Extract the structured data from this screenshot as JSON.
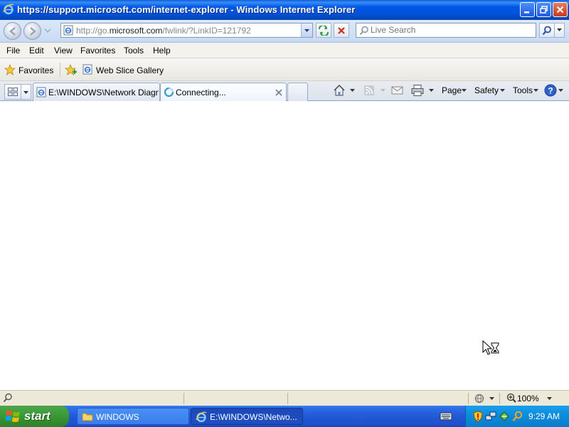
{
  "window": {
    "title": "https://support.microsoft.com/internet-explorer - Windows Internet Explorer"
  },
  "address": {
    "url_prefix": "http://go.",
    "url_domain": "microsoft.com",
    "url_suffix": "/fwlink/?LinkID=121792"
  },
  "search": {
    "placeholder": "Live Search"
  },
  "menu": {
    "items": [
      "File",
      "Edit",
      "View",
      "Favorites",
      "Tools",
      "Help"
    ]
  },
  "favorites_bar": {
    "favorites_label": "Favorites",
    "web_slice_label": "Web Slice Gallery"
  },
  "tabs": [
    {
      "label": "E:\\WINDOWS\\Network Diagn...",
      "active": false
    },
    {
      "label": "Connecting...",
      "active": true
    }
  ],
  "command_bar": {
    "page_label": "Page",
    "safety_label": "Safety",
    "tools_label": "Tools"
  },
  "status_bar": {
    "zoom": "100%"
  },
  "taskbar": {
    "start_label": "start",
    "items": [
      "WINDOWS",
      "E:\\WINDOWS\\Netwo..."
    ],
    "clock": "9:29 AM"
  },
  "colors": {
    "titlebar": "#0058e6",
    "taskbar": "#2259d6",
    "start_button": "#3a9a36",
    "tray": "#0c8ad9"
  }
}
